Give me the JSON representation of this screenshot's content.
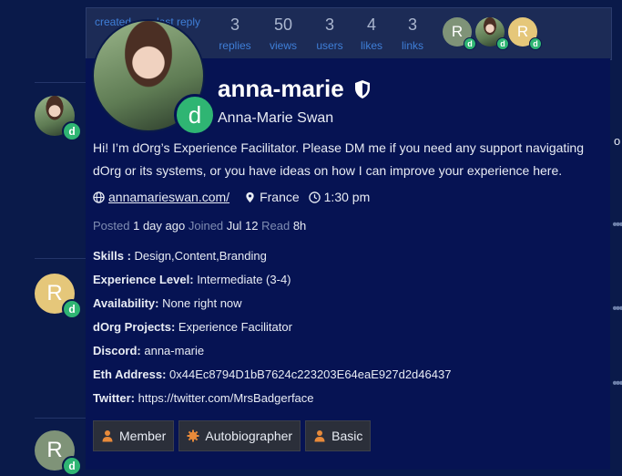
{
  "topic": {
    "created_label": "created",
    "last_reply_label": "last reply",
    "stats": [
      {
        "value": "3",
        "label": "replies"
      },
      {
        "value": "50",
        "label": "views"
      },
      {
        "value": "3",
        "label": "users"
      },
      {
        "value": "4",
        "label": "likes"
      },
      {
        "value": "3",
        "label": "links"
      }
    ],
    "participants": [
      {
        "letter": "R",
        "badge": "d"
      },
      {
        "letter": "",
        "badge": "d"
      },
      {
        "letter": "R",
        "badge": "d"
      }
    ]
  },
  "background": {
    "avatar_letters": [
      "R",
      "R"
    ],
    "badge_letter": "d",
    "edge_text": "o i",
    "dots": "•••"
  },
  "user": {
    "username": "anna-marie",
    "full_name": "Anna-Marie Swan",
    "avatar_badge": "d",
    "bio": "Hi! I’m dOrg’s Experience Facilitator. Please DM me if you need any support navigating dOrg or its systems, or you have ideas on how I can improve your experience here.",
    "website": "annamarieswan.com/",
    "location": "France",
    "local_time": "1:30 pm",
    "posted_label": "Posted",
    "posted_value": "1 day ago",
    "joined_label": "Joined",
    "joined_value": "Jul 12",
    "read_label": "Read",
    "read_value": "8h",
    "fields": [
      {
        "label": "Skills :",
        "value": "Design,Content,Branding"
      },
      {
        "label": "Experience Level:",
        "value": "Intermediate (3-4)"
      },
      {
        "label": "Availability:",
        "value": "None right now"
      },
      {
        "label": "dOrg Projects:",
        "value": "Experience Facilitator"
      },
      {
        "label": "Discord:",
        "value": "anna-marie"
      },
      {
        "label": "Eth Address:",
        "value": "0x44Ec8794D1bB7624c223203E64eaE927d2d46437"
      },
      {
        "label": "Twitter:",
        "value": "https://twitter.com/MrsBadgerface"
      }
    ],
    "groups": [
      {
        "label": "Member",
        "icon": "user-icon"
      },
      {
        "label": "Autobiographer",
        "icon": "badge-gear-icon"
      },
      {
        "label": "Basic",
        "icon": "user-icon"
      }
    ]
  },
  "colors": {
    "background": "#0a1a4a",
    "card": "#061353",
    "link": "#3f7fd8",
    "badge": "#2fb573",
    "group_icon": "#e88a3a"
  }
}
